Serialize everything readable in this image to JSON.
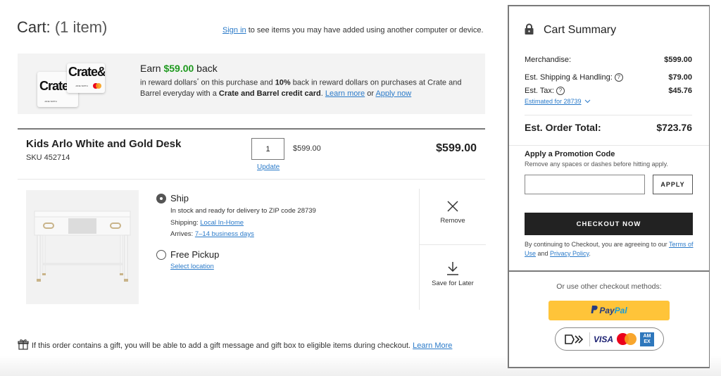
{
  "header": {
    "title": "Cart:",
    "item_count": "(1 item)",
    "sign_in_link": "Sign in",
    "sign_in_message": " to see items you may have added using another computer or device."
  },
  "reward_banner": {
    "card_brand": "Crate&",
    "card_brand_back": "Crate",
    "card_holder": "JANE SMITH",
    "earn_prefix": "Earn ",
    "earn_amount": "$59.00",
    "earn_suffix": " back",
    "desc_1": "in reward dollars",
    "desc_asterisk": "*",
    "desc_2": " on this purchase and ",
    "desc_percent": "10%",
    "desc_3": " back in reward dollars on purchases at Crate and Barrel everyday with a ",
    "desc_card": "Crate and Barrel credit card",
    "desc_4": ". ",
    "learn_more": "Learn more",
    "or": " or ",
    "apply_now": "Apply now"
  },
  "item": {
    "name": "Kids Arlo White and Gold Desk",
    "sku": "SKU 452714",
    "quantity": "1",
    "update_link": "Update",
    "unit_price": "$599.00",
    "line_total": "$599.00",
    "fulfillment": {
      "ship": {
        "label": "Ship",
        "selected": true,
        "stock_message": "In stock and ready for delivery to ZIP code 28739",
        "shipping_label": "Shipping: ",
        "shipping_method": "Local In-Home",
        "arrives_label": "Arrives: ",
        "arrives_value": "7–14 business days"
      },
      "pickup": {
        "label": "Free Pickup",
        "selected": false,
        "select_location": "Select location"
      }
    },
    "actions": {
      "remove": "Remove",
      "save_for_later": "Save for Later"
    }
  },
  "gift_note": {
    "text": "If this order contains a gift, you will be able to add a gift message and gift box to eligible items during checkout. ",
    "link": "Learn More"
  },
  "summary": {
    "title": "Cart Summary",
    "merchandise_label": "Merchandise:",
    "merchandise_value": "$599.00",
    "shipping_label": "Est. Shipping & Handling:",
    "shipping_value": "$79.00",
    "tax_label": "Est. Tax:",
    "tax_value": "$45.76",
    "estimated_for": "Estimated for 28739",
    "total_label": "Est. Order Total:",
    "total_value": "$723.76",
    "help_glyph": "?",
    "promo": {
      "title": "Apply a Promotion Code",
      "subtitle": "Remove any spaces or dashes before hitting apply.",
      "input_value": "",
      "input_placeholder": "",
      "apply_label": "APPLY"
    },
    "checkout_label": "CHECKOUT NOW",
    "terms_prefix": "By continuing to Checkout, you are agreeing to our ",
    "terms_link": "Terms of Use",
    "terms_and": " and ",
    "privacy_link": "Privacy Policy",
    "terms_end": ".",
    "other_methods": "Or use other checkout methods:",
    "paypal_1": "Pay",
    "paypal_2": "Pal",
    "visa": "VISA",
    "amex_1": "AM",
    "amex_2": "EX"
  },
  "colors": {
    "link": "#2a7ac9",
    "reward_green": "#1f9a1f",
    "checkout_bg": "#222222",
    "paypal_yellow": "#ffc439"
  }
}
